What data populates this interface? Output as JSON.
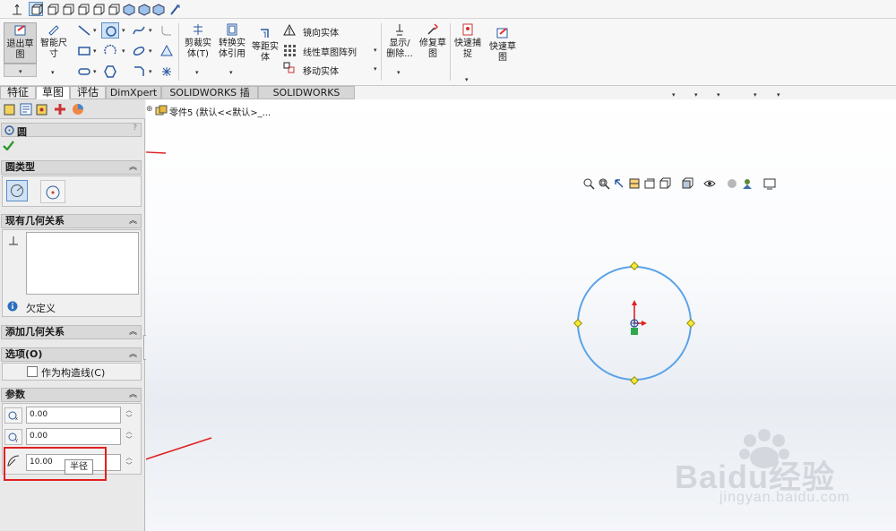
{
  "ribbon": {
    "exit_sketch": "退出草\n图",
    "smart_dim": "智能尺\n寸",
    "trim": "剪裁实\n体(T)",
    "convert": "转换实\n体引用",
    "offset": "等距实\n体",
    "mirror": "镜向实体",
    "linear_pattern": "线性草图阵列",
    "move": "移动实体",
    "show_hide": "显示/\n删除...",
    "repair": "修复草\n图",
    "quick_snap": "快速捕\n捉",
    "rapid_sketch": "快速草\n图"
  },
  "tabs": [
    "特征",
    "草图",
    "评估",
    "DimXpert",
    "SOLIDWORKS 插件",
    "SOLIDWORKS MBD"
  ],
  "tree": {
    "part": "零件5  (默认<<默认>_..."
  },
  "panel": {
    "title": "圆",
    "help": "?",
    "circle_type": "圆类型",
    "existing_relations": "现有几何关系",
    "under_defined": "欠定义",
    "add_relations": "添加几何关系",
    "options": "选项(O)",
    "construction": "作为构造线(C)",
    "parameters": "参数",
    "cx": "0.00",
    "cy": "0.00",
    "radius": "10.00",
    "radius_tip": "半径"
  },
  "watermark": {
    "brand": "Baidu经验",
    "url": "jingyan.baidu.com"
  },
  "colors": {
    "accent": "#5a8dc4",
    "circle": "#5aa3e8",
    "annotation_red": "#e02020",
    "check_green": "#2e9b2e"
  }
}
